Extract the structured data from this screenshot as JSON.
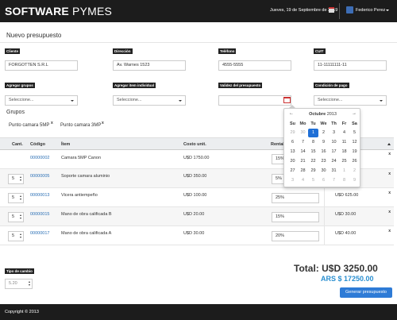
{
  "header": {
    "brand_bold": "SOFTWARE",
    "brand_light": " PYMES",
    "date": "Jueves, 19 de Septiembre de 2019",
    "user": "Federico Perez"
  },
  "page": {
    "title": "Nuevo presupuesto"
  },
  "form": {
    "cliente": {
      "label": "Cliente",
      "value": "FORGOTTEN S.R.L"
    },
    "direccion": {
      "label": "Dirección",
      "value": "Av. Warnes 1523"
    },
    "telefono": {
      "label": "Teléfono",
      "value": "4555-5555"
    },
    "cuit": {
      "label": "CUIT",
      "value": "11-11111111-11"
    },
    "grupos": {
      "label": "Agregar grupos",
      "value": "Seleccione..."
    },
    "item": {
      "label": "Agregar item individual",
      "value": "Seleccione..."
    },
    "validez": {
      "label": "Validez del presupuesto",
      "value": ""
    },
    "condicion": {
      "label": "Condición de pago",
      "value": "Seleccione..."
    }
  },
  "groups": {
    "title": "Grupos",
    "tags": [
      "Punto camara 5MP",
      "Punto camara 3MP"
    ],
    "remove_glyph": "x"
  },
  "table": {
    "headers": [
      "Cant.",
      "Código",
      "Ítem",
      "Costo unit.",
      "Rentab"
    ],
    "rows": [
      {
        "qty": "",
        "code": "00000002",
        "item": "Camara 5MP Canon",
        "cost": "U$D 1750.00",
        "rent": "15%",
        "total": ""
      },
      {
        "qty": "5",
        "code": "00000005",
        "item": "Soporte camara aluminio",
        "cost": "U$D 350.00",
        "rent": "5%",
        "total": ""
      },
      {
        "qty": "5",
        "code": "00000013",
        "item": "Vicera antiempeño",
        "cost": "U$D 100.00",
        "rent": "25%",
        "total": "U$D 625.00"
      },
      {
        "qty": "5",
        "code": "00000015",
        "item": "Mano de obra calificada B",
        "cost": "U$D 20.00",
        "rent": "15%",
        "total": "U$D 30.00"
      },
      {
        "qty": "5",
        "code": "00000017",
        "item": "Mano de obra calificada A",
        "cost": "U$D 30.00",
        "rent": "20%",
        "total": "U$D 40.00"
      }
    ]
  },
  "tipo_cambio": {
    "label": "Tipo de cambio",
    "value": "5.20"
  },
  "totals": {
    "usd": "Total: U$D 3250.00",
    "ars": "ARS $ 17250.00"
  },
  "actions": {
    "generar": "Generar presupuesto"
  },
  "footer": {
    "copyright": "Copyright © 2013"
  },
  "datepicker": {
    "prev": "←",
    "next": "→",
    "month": "Octubre",
    "year": "2013",
    "dow": [
      "Su",
      "Mo",
      "Tu",
      "We",
      "Th",
      "Fr",
      "Sa"
    ],
    "weeks": [
      [
        "29",
        "30",
        "1",
        "2",
        "3",
        "4",
        "5"
      ],
      [
        "6",
        "7",
        "8",
        "9",
        "10",
        "11",
        "12"
      ],
      [
        "13",
        "14",
        "15",
        "16",
        "17",
        "18",
        "19"
      ],
      [
        "20",
        "21",
        "22",
        "23",
        "24",
        "25",
        "26"
      ],
      [
        "27",
        "28",
        "29",
        "30",
        "31",
        "1",
        "2"
      ],
      [
        "3",
        "4",
        "5",
        "6",
        "7",
        "8",
        "9"
      ]
    ],
    "selected": "1",
    "accent": "#1f6fd6"
  },
  "colors": {
    "topbar": "#1c1c1c",
    "link": "#2a6fb5",
    "ars_total": "#2a8fd0",
    "button": "#2e7bd6"
  }
}
